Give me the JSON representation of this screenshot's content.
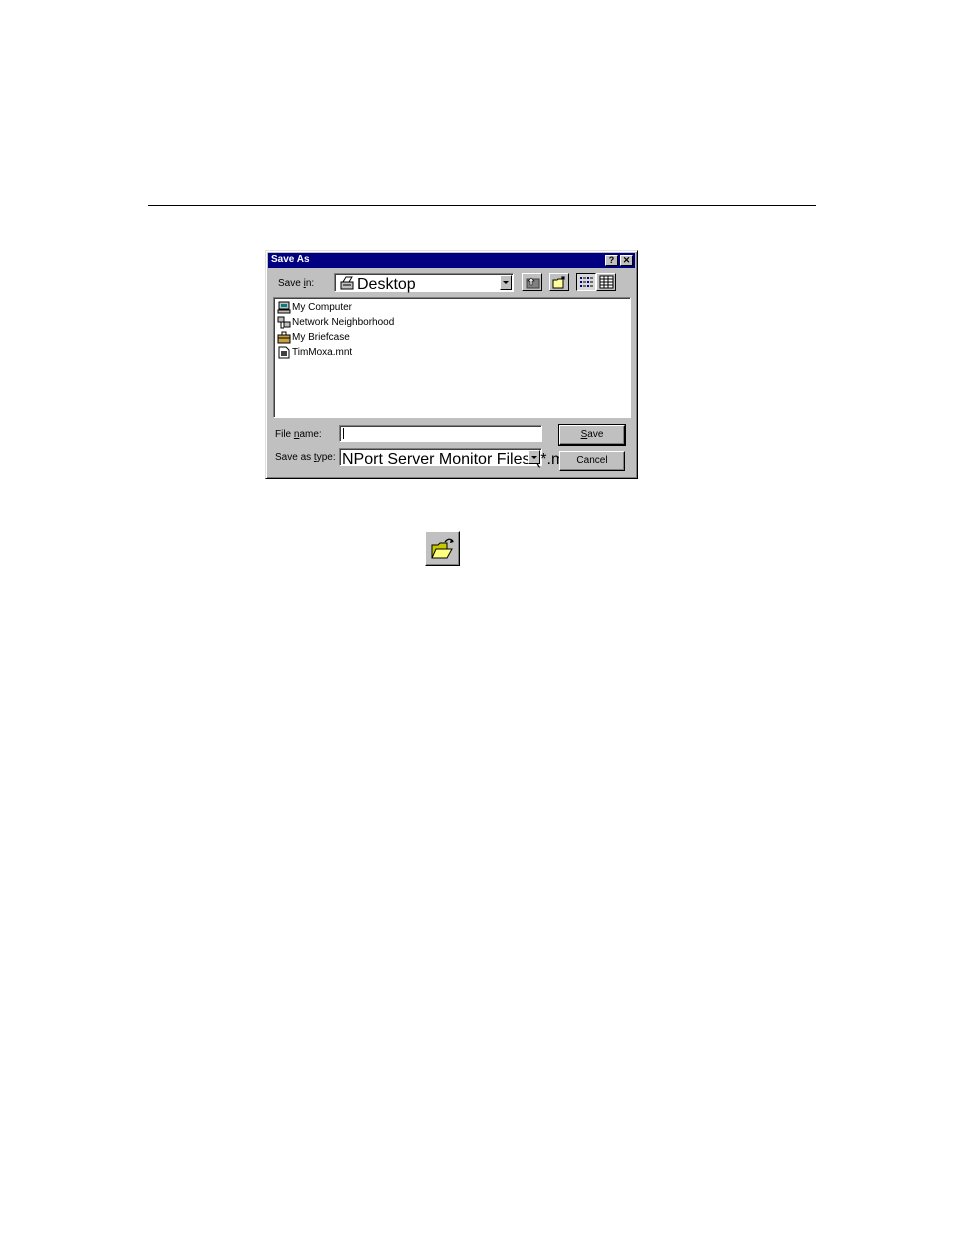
{
  "dialog": {
    "title": "Save As",
    "help_button": "?",
    "close_button": "✕",
    "save_in": {
      "label_pre": "Save ",
      "label_key": "i",
      "label_post": "n:",
      "value": "Desktop"
    },
    "toolbar": {
      "up_icon": "up-one-level-icon",
      "new_folder_icon": "create-new-folder-icon",
      "list_icon": "list-view-icon",
      "details_icon": "details-view-icon"
    },
    "files": [
      {
        "label": "My Computer",
        "icon": "my-computer-icon"
      },
      {
        "label": "Network Neighborhood",
        "icon": "network-neighborhood-icon"
      },
      {
        "label": "My Briefcase",
        "icon": "briefcase-icon"
      },
      {
        "label": "TimMoxa.mnt",
        "icon": "file-icon"
      }
    ],
    "file_name": {
      "label_pre": "File ",
      "label_key": "n",
      "label_post": "ame:",
      "value": ""
    },
    "save_as_type": {
      "label_pre": "Save as ",
      "label_key": "t",
      "label_post": "ype:",
      "value": "NPort Server Monitor Files (*.mnt)"
    },
    "save_button": {
      "key": "S",
      "rest": "ave"
    },
    "cancel_button": "Cancel"
  },
  "open_toolbar_button": {
    "icon": "open-folder-icon"
  },
  "colors": {
    "title_bar": "#000080",
    "dialog_bg": "#c0c0c0"
  }
}
